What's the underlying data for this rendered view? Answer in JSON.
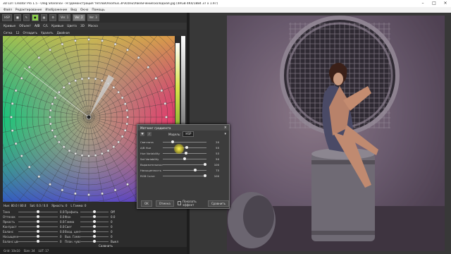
{
  "titlebar": {
    "title": "3D LUT Creator Pro 1.5 - Oleg Sharonov - H:\\Демонстрация теплой\\Anomus.3P3Ozeu\\Увеличение\\холодная.jpg (4RGB 4K4/1884 37 x 1.97)"
  },
  "menubar": {
    "items": [
      "Файл",
      "Редактирование",
      "Изображение",
      "Вид",
      "Окно",
      "Помощь"
    ]
  },
  "toolbar": {
    "hsp": "HSP",
    "ver_a": "Ver. 1",
    "ver_b": "Ver. 2",
    "ver_c": "Ver. 3"
  },
  "tabs": {
    "items": [
      "Кривые",
      "Объект",
      "A/B",
      "C/L",
      "Кривые",
      "Цвета",
      "3D",
      "Маска"
    ]
  },
  "row3": {
    "items": [
      "Сетка",
      "12",
      "Отладить",
      "Удалить",
      "Двойная"
    ]
  },
  "bottom": {
    "head": [
      "Hue: 80.0 / 80.0",
      "Sat: 0.0 / 0.0",
      "Яркость: 0",
      "L Гамма: 0"
    ],
    "left_sliders": [
      {
        "label": "Тона",
        "value": "0.0"
      },
      {
        "label": "Оттенок",
        "value": "0.0"
      },
      {
        "label": "Яркость",
        "value": "0.0"
      },
      {
        "label": "Контраст",
        "value": "0.0"
      },
      {
        "label": "Баланс",
        "value": "0.0"
      },
      {
        "label": "Насыщенность",
        "value": "0"
      },
      {
        "label": "Баланс цвета",
        "value": "0"
      }
    ],
    "right_sliders": [
      {
        "label": "Профиль",
        "value": "Off"
      },
      {
        "label": "Фон",
        "value": "0.0"
      },
      {
        "label": "Гамма",
        "value": "0"
      },
      {
        "label": "Свет",
        "value": "0"
      },
      {
        "label": "Вход. центр",
        "value": "0"
      },
      {
        "label": "Вых. Гамма",
        "value": "0"
      },
      {
        "label": "План. чувс.",
        "value": "Выкл"
      }
    ],
    "compare_label": "Сравнить"
  },
  "statusbar": {
    "items": [
      "Grid: 10x10",
      "Size: 34",
      "LUT: 17"
    ]
  },
  "dialog": {
    "title": "Матчинг градиента",
    "mode_label": "Модель:",
    "mode_value": "HSP",
    "rows": [
      {
        "label": "Светлота",
        "value": "20"
      },
      {
        "label": "A/B Hue",
        "value": "55"
      },
      {
        "label": "Hue Variability",
        "value": "53"
      },
      {
        "label": "Sat Variability",
        "value": "50"
      },
      {
        "label": "Выразительность",
        "value": "100"
      },
      {
        "label": "Насыщенность",
        "value": "75"
      },
      {
        "label": "RGB Curve",
        "value": "100"
      }
    ],
    "ok_label": "OK",
    "cancel_label": "Отмена",
    "preview_label": "Показать эффект",
    "compare_label": "Сравнить"
  }
}
